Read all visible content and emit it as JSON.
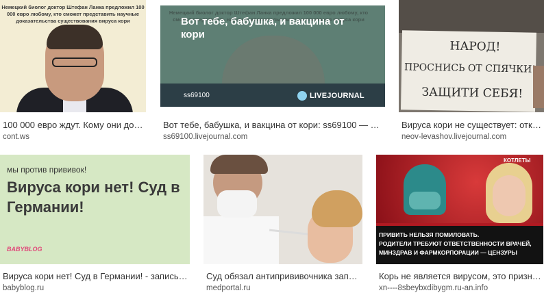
{
  "row1": [
    {
      "caption": "100 000 евро ждут. Кому они дос...",
      "source": "cont.ws",
      "thumb_text": "Немецкий биолог доктор Штефан Ланка предложил 100 000 евро любому, кто сможет представить научные доказательства существования вируса кори"
    },
    {
      "caption": "Вот тебе, бабушка, и вакцина от кори: ss69100 — Liv...",
      "source": "ss69100.livejournal.com",
      "thumb_bg_text": "Немецкий биолог доктор Штефан Ланка предложил 100 000 евро любому, кто сможет представить научные доказательства существования вируса кори",
      "thumb_title": "Вот тебе, бабушка, и вакцина от кори",
      "thumb_user": "ss69100",
      "thumb_logo": "LIVEJOURNAL"
    },
    {
      "caption": "Вирусa кори не существует: отка...",
      "source": "neov-levashov.livejournal.com",
      "sign_lines": [
        "НАРОД!",
        "ПРОСНИСЬ ОТ СПЯЧКИ!",
        "ЗАЩИТИ СЕБЯ!"
      ]
    }
  ],
  "row2": [
    {
      "caption": "Вирусa кори нет! Суд в Германии! - запись п...",
      "source": "babyblog.ru",
      "thumb_tag": "мы против прививок!",
      "thumb_headline": "Вирусa кори нет! Суд в Германии!",
      "thumb_logo": "BABYBLOG"
    },
    {
      "caption": "Суд обязал антипрививочника запла...",
      "source": "medportal.ru"
    },
    {
      "caption": "Корь не является вирусом, это призна...",
      "source": "xn----8sbeybxdibygm.ru-an.info",
      "thumb_corner": "КОТЛЕТЫ",
      "thumb_lines": [
        "ПРИВИТЬ НЕЛЬЗЯ ПОМИЛОВАТЬ.",
        "РОДИТЕЛИ ТРЕБУЮТ ОТВЕТСТВЕННОСТИ ВРАЧЕЙ,",
        "МИНЗДРАВ И ФАРМКОРПОРАЦИИ — ЦЕНЗУРЫ"
      ]
    }
  ]
}
